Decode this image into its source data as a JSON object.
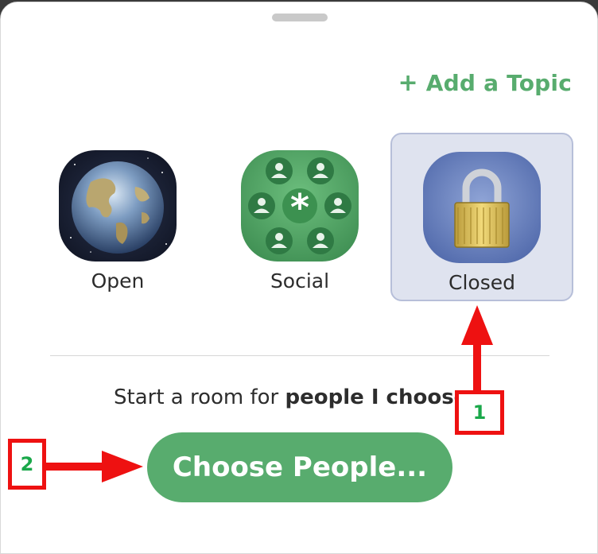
{
  "header": {
    "add_topic_plus": "+",
    "add_topic_label": "Add a Topic"
  },
  "room_types": [
    {
      "label": "Open",
      "icon": "globe-icon",
      "selected": false
    },
    {
      "label": "Social",
      "icon": "social-people-icon",
      "selected": false
    },
    {
      "label": "Closed",
      "icon": "padlock-icon",
      "selected": true
    }
  ],
  "description": {
    "prefix": "Start a room for ",
    "emphasis": "people I choose"
  },
  "primary_button": {
    "label": "Choose People..."
  },
  "callouts": [
    {
      "number": "1"
    },
    {
      "number": "2"
    }
  ],
  "colors": {
    "accent_green": "#58ac6e",
    "selected_bg": "#dfe3ef",
    "annotation_red": "#ee1111",
    "annotation_number": "#1aa84a"
  }
}
